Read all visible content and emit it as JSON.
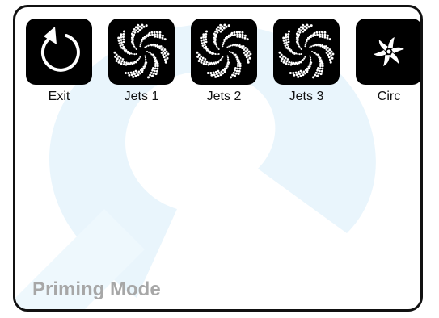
{
  "buttons": [
    {
      "label": "Exit",
      "icon": "exit-icon"
    },
    {
      "label": "Jets 1",
      "icon": "jets-pinwheel-icon"
    },
    {
      "label": "Jets 2",
      "icon": "jets-pinwheel-icon"
    },
    {
      "label": "Jets 3",
      "icon": "jets-pinwheel-icon"
    },
    {
      "label": "Circ",
      "icon": "circulation-pump-icon"
    }
  ],
  "status": {
    "mode_text": "Priming Mode"
  },
  "colors": {
    "tile_background": "#000000",
    "icon_foreground": "#ffffff",
    "mode_text": "#a7a7a7",
    "watermark": "#e9f5fc",
    "frame": "#111111"
  }
}
